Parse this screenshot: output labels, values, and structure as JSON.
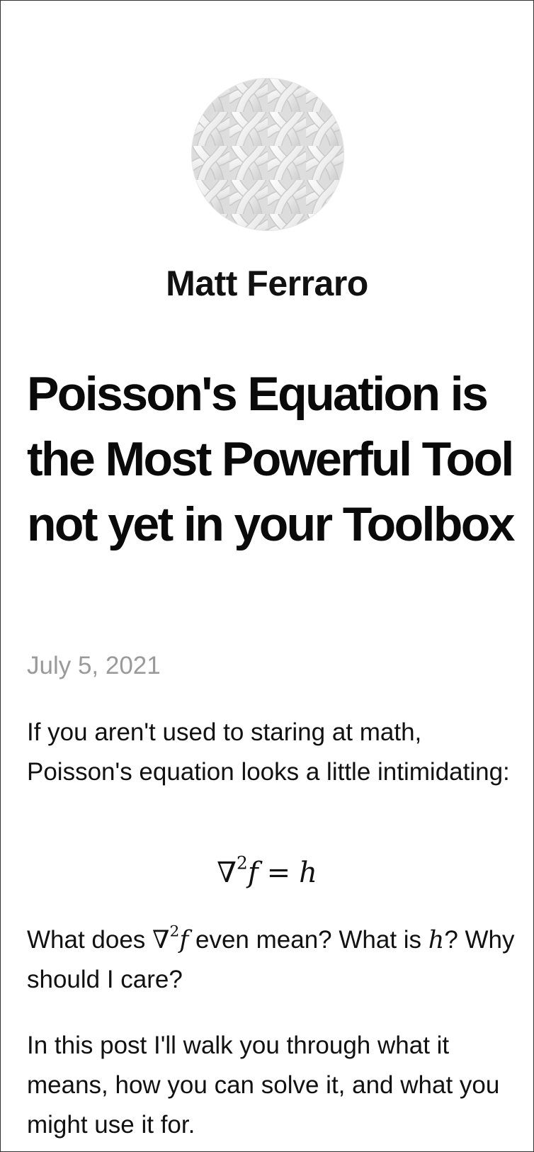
{
  "author": {
    "name": "Matt Ferraro",
    "avatar_icon": "woven-pattern-avatar"
  },
  "post": {
    "title": "Poisson's Equation is the Most Powerful Tool not yet in your Toolbox",
    "date": "July 5, 2021",
    "paragraph1": "If you aren't used to staring at math, Poisson's equation looks a little intimidating:",
    "equation": {
      "nabla": "∇",
      "power": "2",
      "f": "f",
      "equals": "=",
      "h": "h"
    },
    "paragraph2": {
      "before": "What does ",
      "nabla": "∇",
      "power": "2",
      "f": "f",
      "middle": " even mean? What is ",
      "h": "h",
      "after": "? Why should I care?"
    },
    "paragraph3": "In this post I'll walk you through what it means, how you can solve it, and what you might use it for."
  },
  "colors": {
    "text": "#111111",
    "date": "#9a9a9a",
    "border": "#333333",
    "background": "#ffffff"
  }
}
